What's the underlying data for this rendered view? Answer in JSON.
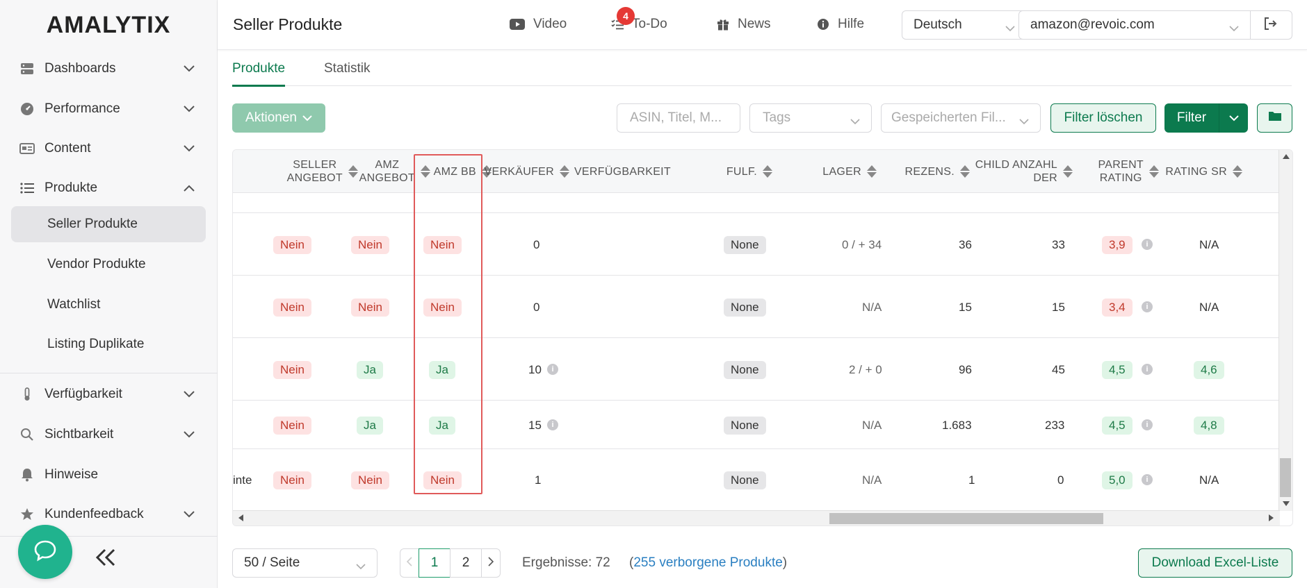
{
  "app": {
    "logo": "AMALYTIX"
  },
  "sidebar": {
    "items": [
      {
        "label": "Dashboards",
        "icon": "server-icon"
      },
      {
        "label": "Performance",
        "icon": "gauge-icon"
      },
      {
        "label": "Content",
        "icon": "id-card-icon"
      },
      {
        "label": "Produkte",
        "icon": "list-icon"
      },
      {
        "label": "Verfügbarkeit",
        "icon": "thermometer-icon"
      },
      {
        "label": "Sichtbarkeit",
        "icon": "search-icon"
      },
      {
        "label": "Hinweise",
        "icon": "bell-icon"
      },
      {
        "label": "Kundenfeedback",
        "icon": "star-icon"
      }
    ],
    "subitems": [
      {
        "label": "Seller Produkte",
        "active": true
      },
      {
        "label": "Vendor Produkte"
      },
      {
        "label": "Watchlist"
      },
      {
        "label": "Listing Duplikate"
      }
    ]
  },
  "header": {
    "title": "Seller Produkte",
    "video": "Video",
    "todo": "To-Do",
    "todo_count": "4",
    "news": "News",
    "hilfe": "Hilfe",
    "language": "Deutsch",
    "account": "amazon@revoic.com"
  },
  "tabs": [
    {
      "label": "Produkte"
    },
    {
      "label": "Statistik"
    }
  ],
  "toolbar": {
    "aktionen": "Aktionen",
    "search_placeholder": "ASIN, Titel, M...",
    "tags_placeholder": "Tags",
    "saved_filter_placeholder": "Gespeicherten Fil...",
    "clear_filter": "Filter löschen",
    "filter": "Filter"
  },
  "table": {
    "headers": {
      "seller_angebot": [
        "SELLER",
        "ANGEBOT"
      ],
      "amz_angebot": [
        "AMZ",
        "ANGEBOT"
      ],
      "amz_bb": "AMZ BB",
      "verkaeufer": "VERKÄUFER",
      "verfuegbarkeit": "VERFÜGBARKEIT",
      "fulf": "FULF.",
      "lager": "LAGER",
      "rezens": "REZENS.",
      "child_anzahl": [
        "CHILD ANZAHL",
        "DER"
      ],
      "parent_rating": [
        "PARENT",
        "RATING"
      ],
      "rating_sr": "RATING SR"
    },
    "rows": [
      {
        "prefix": "",
        "seller": "Nein",
        "amz": "Nein",
        "bb": "Nein",
        "verk": "0",
        "verk_info": false,
        "fulf": "None",
        "lager": "0 / + 34",
        "rezens": "36",
        "child": "33",
        "rating": "3,9",
        "rating_tone": "red",
        "sr": "N/A",
        "sr_pill": false
      },
      {
        "prefix": "",
        "seller": "Nein",
        "amz": "Nein",
        "bb": "Nein",
        "verk": "0",
        "verk_info": false,
        "fulf": "None",
        "lager": "N/A",
        "rezens": "15",
        "child": "15",
        "rating": "3,4",
        "rating_tone": "red",
        "sr": "N/A",
        "sr_pill": false
      },
      {
        "prefix": "",
        "seller": "Nein",
        "amz": "Ja",
        "bb": "Ja",
        "verk": "10",
        "verk_info": true,
        "fulf": "None",
        "lager": "2 / + 0",
        "rezens": "96",
        "child": "45",
        "rating": "4,5",
        "rating_tone": "green",
        "sr": "4,6",
        "sr_pill": true
      },
      {
        "prefix": "",
        "seller": "Nein",
        "amz": "Ja",
        "bb": "Ja",
        "verk": "15",
        "verk_info": true,
        "fulf": "None",
        "lager": "N/A",
        "rezens": "1.683",
        "child": "233",
        "rating": "4,5",
        "rating_tone": "green",
        "sr": "4,8",
        "sr_pill": true
      },
      {
        "prefix": "inte",
        "seller": "Nein",
        "amz": "Nein",
        "bb": "Nein",
        "verk": "1",
        "verk_info": false,
        "fulf": "None",
        "lager": "N/A",
        "rezens": "1",
        "child": "0",
        "rating": "5,0",
        "rating_tone": "green",
        "sr": "N/A",
        "sr_pill": false
      }
    ]
  },
  "footer": {
    "per_page": "50 / Seite",
    "pages": [
      "1",
      "2"
    ],
    "current_page": "1",
    "results": "Ergebnisse: 72",
    "hidden_open": "(",
    "hidden_link": "255 verborgene Produkte",
    "hidden_close": ")",
    "download": "Download Excel-Liste"
  },
  "colors": {
    "brand_green": "#0c7a4e",
    "badge_red": "#e53935",
    "highlight_red": "#e05a5a"
  }
}
